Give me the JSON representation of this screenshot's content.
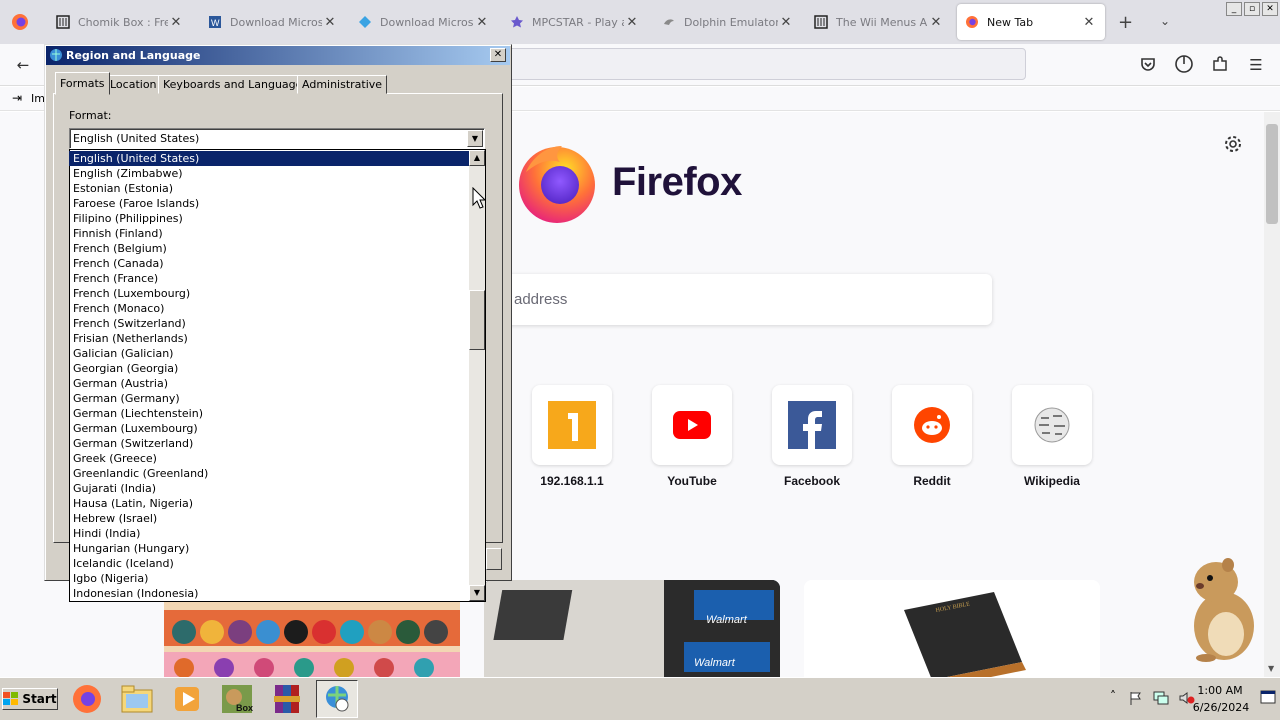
{
  "browser": {
    "tabs": [
      {
        "title": "Chomik Box : Free",
        "active": false
      },
      {
        "title": "Download Microsof",
        "active": false
      },
      {
        "title": "Download Microsof",
        "active": false
      },
      {
        "title": "MPCSTAR - Play al",
        "active": false
      },
      {
        "title": "Dolphin Emulator",
        "active": false
      },
      {
        "title": "The Wii Menus Ar",
        "active": false
      },
      {
        "title": "New Tab",
        "active": true
      }
    ],
    "bookmark_item": "Im",
    "window_buttons": [
      "_",
      "▫",
      "✕"
    ]
  },
  "newtab": {
    "brand": "Firefox",
    "search_placeholder": "address",
    "top_sites": [
      {
        "label": "192.168.1.1"
      },
      {
        "label": "YouTube"
      },
      {
        "label": "Facebook"
      },
      {
        "label": "Reddit"
      },
      {
        "label": "Wikipedia"
      }
    ],
    "story_tiles": [
      {
        "text": "Walmart"
      },
      {
        "text": "Walmart"
      },
      {
        "text": "HOLY BIBLE"
      }
    ]
  },
  "dialog": {
    "title": "Region and Language",
    "tabs": [
      "Formats",
      "Location",
      "Keyboards and Languages",
      "Administrative"
    ],
    "format_label": "Format:",
    "format_value": "English (United States)",
    "options": [
      "English (United States)",
      "English (Zimbabwe)",
      "Estonian (Estonia)",
      "Faroese (Faroe Islands)",
      "Filipino (Philippines)",
      "Finnish (Finland)",
      "French (Belgium)",
      "French (Canada)",
      "French (France)",
      "French (Luxembourg)",
      "French (Monaco)",
      "French (Switzerland)",
      "Frisian (Netherlands)",
      "Galician (Galician)",
      "Georgian (Georgia)",
      "German (Austria)",
      "German (Germany)",
      "German (Liechtenstein)",
      "German (Luxembourg)",
      "German (Switzerland)",
      "Greek (Greece)",
      "Greenlandic (Greenland)",
      "Gujarati (India)",
      "Hausa (Latin, Nigeria)",
      "Hebrew (Israel)",
      "Hindi (India)",
      "Hungarian (Hungary)",
      "Icelandic (Iceland)",
      "Igbo (Nigeria)",
      "Indonesian (Indonesia)"
    ]
  },
  "taskbar": {
    "start_label": "Start",
    "start_sub": "Box",
    "time": "1:00 AM",
    "date": "6/26/2024"
  },
  "colors": {
    "dialog_title_start": "#0a246a",
    "dialog_title_end": "#a6caf0",
    "selection": "#0a246a",
    "classic_face": "#d4d0c8"
  }
}
